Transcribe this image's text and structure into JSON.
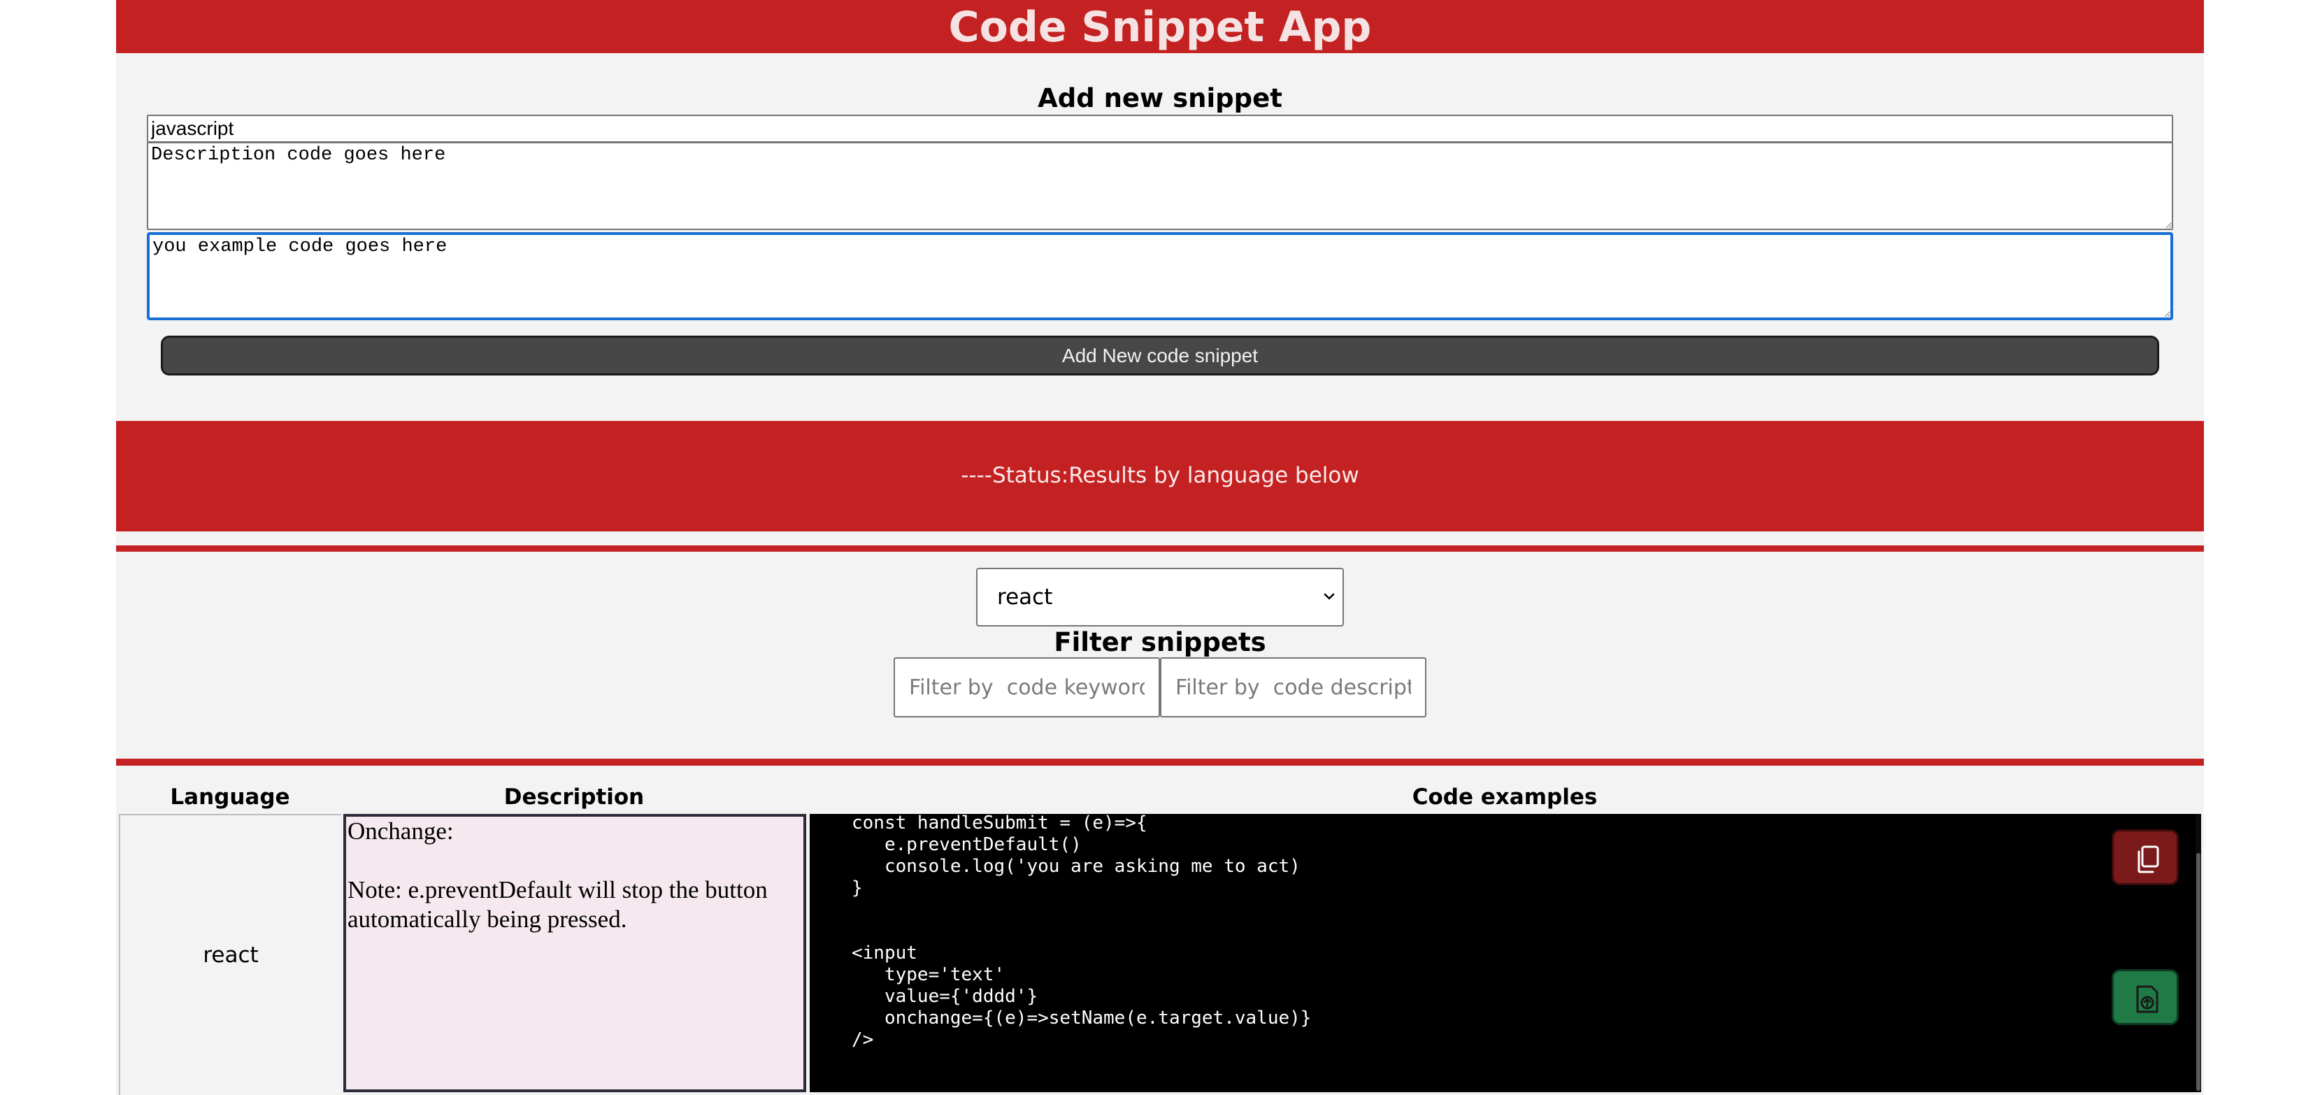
{
  "header": {
    "title": "Code Snippet App"
  },
  "add_form": {
    "heading": "Add new snippet",
    "language_value": "javascript",
    "description_value": "Description code goes here",
    "code_value": "you example code goes here",
    "submit_label": "Add New code snippet"
  },
  "status": {
    "text": "----Status:Results by language below"
  },
  "filter": {
    "language_selected": "react",
    "heading": "Filter snippets",
    "keyword_placeholder": "Filter by  code keyword",
    "description_placeholder": "Filter by  code description"
  },
  "table": {
    "headers": {
      "language": "Language",
      "description": "Description",
      "code": "Code examples"
    },
    "rows": [
      {
        "language": "react",
        "description": "Onchange:\n\nNote: e.preventDefault will stop the button automatically being pressed.",
        "code": "const handleSubmit = (e)=>{\n   e.preventDefault()\n   console.log('you are asking me to act)\n}\n\n\n<input\n   type='text'\n   value={'dddd'}\n   onchange={(e)=>setName(e.target.value)}\n/>"
      }
    ]
  },
  "colors": {
    "primary_red": "#c42222",
    "copy_button": "#7a1a1a",
    "save_button": "#1f7a45",
    "description_bg": "#f5e9ef"
  },
  "icons": {
    "copy": "copy-icon",
    "save": "save-icon",
    "dropdown": "chevron-down-icon"
  }
}
